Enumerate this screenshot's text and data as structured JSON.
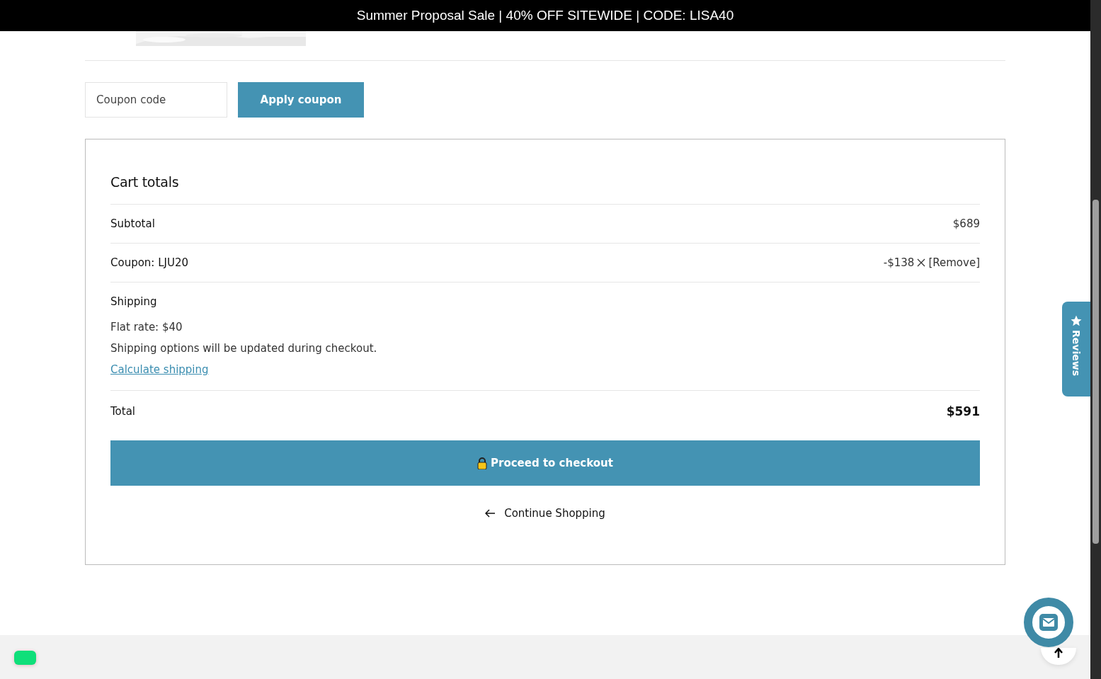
{
  "banner": {
    "text": "Summer Proposal Sale | 40% OFF SITEWIDE | CODE: LISA40"
  },
  "coupon": {
    "placeholder": "Coupon code",
    "button": "Apply coupon"
  },
  "cart_totals": {
    "title": "Cart totals",
    "subtotal": {
      "label": "Subtotal",
      "value": "$689"
    },
    "coupon_line": {
      "label": "Coupon: LJU20",
      "value": "-$138",
      "remove": "[Remove]"
    },
    "shipping": {
      "label": "Shipping",
      "rate": "Flat rate: $40",
      "note": "Shipping options will be updated during checkout.",
      "link": "Calculate shipping"
    },
    "total": {
      "label": "Total",
      "value": "$591"
    },
    "checkout_button": "Proceed to checkout",
    "continue_link": "Continue Shopping"
  },
  "reviews_tab": {
    "label": "Reviews"
  }
}
